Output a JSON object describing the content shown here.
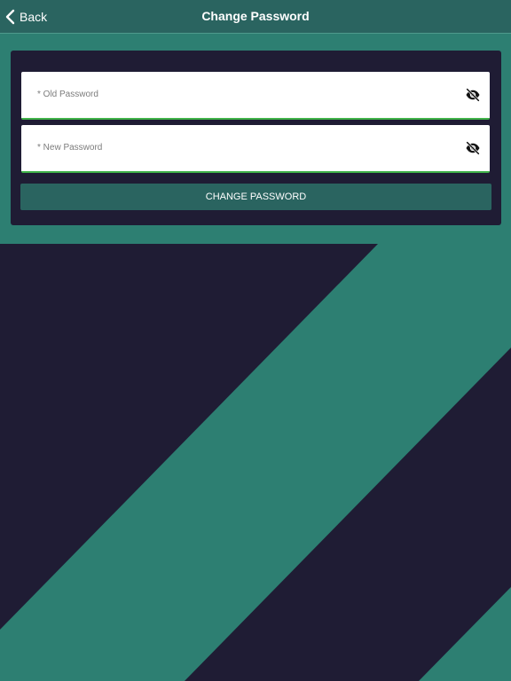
{
  "nav": {
    "back_label": "Back",
    "title": "Change Password"
  },
  "form": {
    "old_password_placeholder": "* Old Password",
    "new_password_placeholder": "* New Password",
    "submit_label": "CHANGE PASSWORD"
  },
  "icons": {
    "back": "chevron-left-icon",
    "toggle_visibility": "eye-off-icon"
  },
  "colors": {
    "navbar": "#2a6460",
    "background_teal": "#2d7f72",
    "background_dark": "#1f1c34",
    "card": "#1f1c34",
    "field_underline": "#41b34a",
    "button": "#2a6460"
  }
}
